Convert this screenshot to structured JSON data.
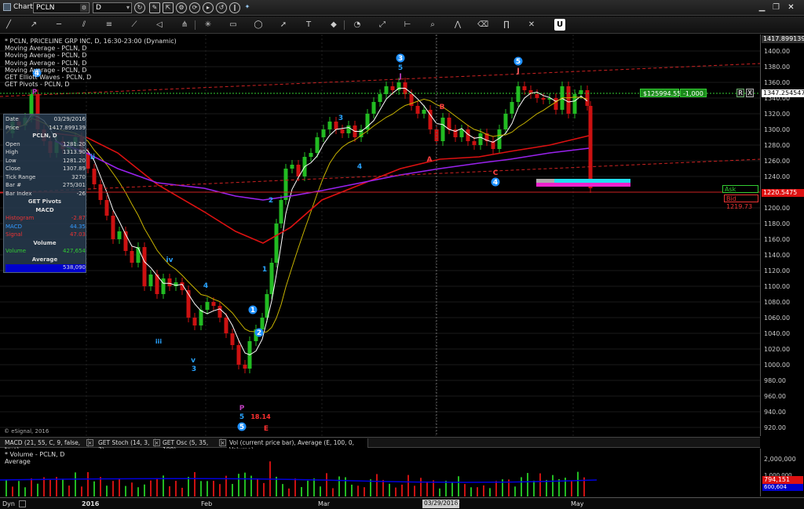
{
  "window": {
    "title": "Chart",
    "symbol": "PCLN",
    "interval": "D"
  },
  "toolbar_icons": [
    "link-icon",
    "cursor-icon",
    "draw-icon",
    "settings-icon",
    "cycle-icon",
    "play-icon",
    "refresh-icon",
    "pause-icon",
    "twitter-icon"
  ],
  "draw_tools": [
    "line-tool",
    "ray-tool",
    "horizontal-line-tool",
    "channel-tool",
    "fib-tool",
    "trend-tool",
    "wedge-tool",
    "pitchfork-tool",
    "gann-tool",
    "rectangle-tool",
    "ellipse-tool",
    "arrow-tool",
    "text-tool",
    "marker-tool",
    "cycle-tool",
    "regression-tool",
    "measure-tool",
    "zoom-tool",
    "pitch-tool",
    "eraser-tool",
    "pti-tool",
    "delete-tool"
  ],
  "legend": {
    "lines": [
      "* PCLN, PRICELINE GRP INC, D, 16:30-23:00 (Dynamic)",
      "Moving Average - PCLN, D",
      "Moving Average - PCLN, D",
      "Moving Average - PCLN, D",
      "Moving Average - PCLN, D",
      "GET Elliott Waves - PCLN, D",
      "GET Pivots - PCLN, D"
    ]
  },
  "data_window": {
    "rows": [
      {
        "k": "Date",
        "v": "03/29/2016"
      },
      {
        "k": "Price",
        "v": "1417.899139"
      },
      {
        "k": "",
        "v": "PCLN, D",
        "center": true
      },
      {
        "k": "Open",
        "v": "1281.20"
      },
      {
        "k": "High",
        "v": "1313.90"
      },
      {
        "k": "Low",
        "v": "1281.20"
      },
      {
        "k": "Close",
        "v": "1307.89"
      },
      {
        "k": "Tick Range",
        "v": "3270"
      },
      {
        "k": "Bar #",
        "v": "275/301"
      },
      {
        "k": "Bar Index",
        "v": "-26"
      },
      {
        "k": "",
        "v": "GET Pivots",
        "center": true
      },
      {
        "k": "",
        "v": "MACD",
        "center": true
      },
      {
        "k": "Histogram",
        "v": "-2.87"
      },
      {
        "k": "MACD",
        "v": "44.35"
      },
      {
        "k": "Signal",
        "v": "47.03"
      },
      {
        "k": "",
        "v": "Volume",
        "center": true
      },
      {
        "k": "Volume",
        "v": "427,654"
      },
      {
        "k": "",
        "v": "Average",
        "center": true
      },
      {
        "k": "",
        "v": "538,090"
      }
    ]
  },
  "price_axis": {
    "ticks": [
      "1400.00",
      "1380.00",
      "1360.00",
      "1340.00",
      "1320.00",
      "1300.00",
      "1280.00",
      "1260.00",
      "1240.00",
      "1220.00",
      "1200.00",
      "1180.00",
      "1160.00",
      "1140.00",
      "1120.00",
      "1100.00",
      "1080.00",
      "1060.00",
      "1040.00",
      "1020.00",
      "1000.00",
      "980.00",
      "960.00",
      "940.00",
      "920.00"
    ],
    "top_flag": "1417.899139",
    "current": "1347.254547",
    "last": "1220.5475",
    "ask": "Ask 1221.25",
    "bid": "Bid 1219.73"
  },
  "position": {
    "value": "$125994.55",
    "qty": "-1,000",
    "r_btn": "R",
    "x_btn": "X"
  },
  "wave_labels": [
    {
      "t": "3",
      "c": "#29a3ff",
      "circle": true
    },
    {
      "t": "5",
      "c": "#29a3ff"
    },
    {
      "t": "J",
      "c": "#c040c0"
    },
    {
      "t": "5",
      "c": "#29a3ff",
      "circle": true
    },
    {
      "t": "J",
      "c": "#ff6060"
    },
    {
      "t": "4",
      "c": "#29a3ff",
      "circle": true
    },
    {
      "t": "P",
      "c": "#c040c0"
    },
    {
      "t": "3",
      "c": "#29a3ff"
    },
    {
      "t": "4",
      "c": "#29a3ff"
    },
    {
      "t": "B",
      "c": "#ff4040"
    },
    {
      "t": "A",
      "c": "#ff4040"
    },
    {
      "t": "C",
      "c": "#ff4040"
    },
    {
      "t": "4",
      "c": "#29a3ff",
      "circle": true
    },
    {
      "t": "2",
      "c": "#29a3ff"
    },
    {
      "t": "1",
      "c": "#29a3ff"
    },
    {
      "t": "1",
      "c": "#29a3ff",
      "circle": true
    },
    {
      "t": "2",
      "c": "#29a3ff",
      "circle": true
    },
    {
      "t": "iv",
      "c": "#29a3ff"
    },
    {
      "t": "4",
      "c": "#29a3ff"
    },
    {
      "t": "iii",
      "c": "#29a3ff"
    },
    {
      "t": "v",
      "c": "#29a3ff"
    },
    {
      "t": "3",
      "c": "#29a3ff"
    },
    {
      "t": "P",
      "c": "#c040c0"
    },
    {
      "t": "5",
      "c": "#29a3ff"
    },
    {
      "t": "5",
      "c": "#29a3ff",
      "circle": true
    },
    {
      "t": "18.14",
      "c": "#ff3030"
    },
    {
      "t": "E",
      "c": "#ff3030"
    },
    {
      "t": "ii",
      "c": "#29a3ff"
    }
  ],
  "watermark": "© eSignal, 2016",
  "study_tabs": [
    {
      "label": "MACD (21, 55, C, 9, false, true)"
    },
    {
      "label": "GET Stoch (14, 3, 3)"
    },
    {
      "label": "GET Osc (5, 35, 100)"
    },
    {
      "label": "Vol (current price bar), Average (E, 100, 0, Volume)",
      "active": true
    }
  ],
  "volume_pane": {
    "legend_1": "* Volume - PCLN, D",
    "legend_2": "Average",
    "ticks": [
      "2,000,000",
      "1,000,000"
    ],
    "current_flag": "794,151",
    "avg_flag": "600,604"
  },
  "time_axis": {
    "dyn": "Dyn",
    "labels": [
      "2016",
      "Feb",
      "Mar",
      "pr",
      "May"
    ],
    "cursor": "03/29/2016"
  },
  "colors": {
    "up": "#22bb22",
    "down": "#cc1111",
    "ma_white": "#ffffff",
    "ma_yellow": "#c8b400",
    "ma_red": "#dd1111",
    "ma_purple": "#9922ee",
    "volume": "#0000dd"
  }
}
